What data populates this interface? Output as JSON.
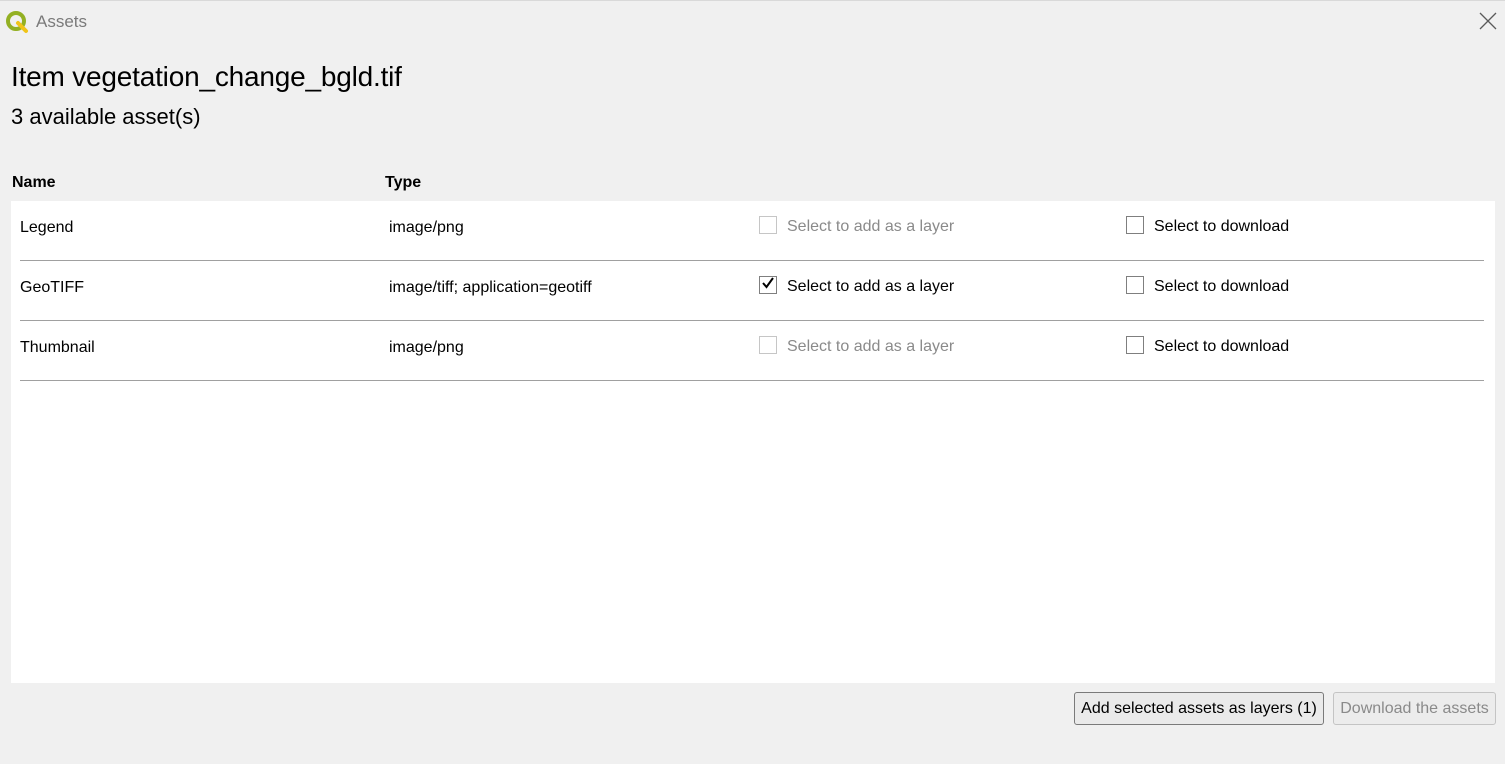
{
  "window": {
    "title": "Assets",
    "app_icon": "qgis-logo-icon",
    "close_icon": "close-icon"
  },
  "heading": {
    "item_title": "Item vegetation_change_bgld.tif",
    "asset_count": "3 available asset(s)"
  },
  "columns": {
    "name": "Name",
    "type": "Type"
  },
  "assets": [
    {
      "name": "Legend",
      "type": "image/png",
      "layer_label": "Select to add as a layer",
      "layer_checked": false,
      "layer_enabled": false,
      "download_label": "Select to download",
      "download_checked": false
    },
    {
      "name": "GeoTIFF",
      "type": "image/tiff; application=geotiff",
      "layer_label": "Select to add as a layer",
      "layer_checked": true,
      "layer_enabled": true,
      "download_label": "Select to download",
      "download_checked": false
    },
    {
      "name": "Thumbnail",
      "type": "image/png",
      "layer_label": "Select to add as a layer",
      "layer_checked": false,
      "layer_enabled": false,
      "download_label": "Select to download",
      "download_checked": false
    }
  ],
  "buttons": {
    "add_layers": "Add selected assets as layers (1)",
    "download": "Download the assets"
  },
  "colors": {
    "qgis_green": "#93b023",
    "qgis_yellow": "#f0c419"
  }
}
